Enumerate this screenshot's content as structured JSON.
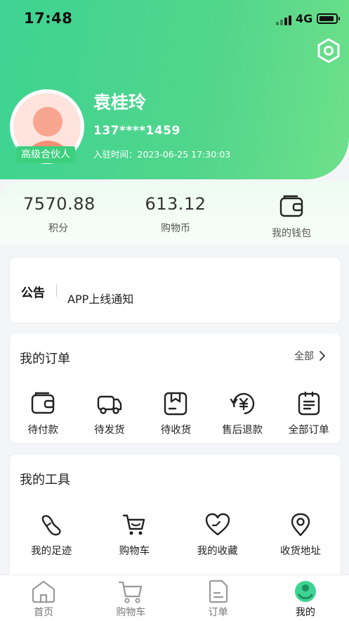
{
  "status": {
    "time": "17:48",
    "network": "4G"
  },
  "profile": {
    "name": "袁桂玲",
    "phone": "137****1459",
    "joined": "入驻时间：2023-06-25 17:30:03",
    "badge": "高级合伙人"
  },
  "stats": {
    "points_value": "7570.88",
    "points_label": "积分",
    "coins_value": "613.12",
    "coins_label": "购物币",
    "wallet_label": "我的钱包"
  },
  "notice": {
    "title": "公告",
    "text": "APP上线通知"
  },
  "orders": {
    "title": "我的订单",
    "all_label": "全部",
    "items": [
      {
        "label": "待付款",
        "icon": "wallet-icon"
      },
      {
        "label": "待发货",
        "icon": "truck-icon"
      },
      {
        "label": "待收货",
        "icon": "package-icon"
      },
      {
        "label": "售后退款",
        "icon": "refund-icon"
      },
      {
        "label": "全部订单",
        "icon": "document-icon"
      }
    ]
  },
  "tools": {
    "title": "我的工具",
    "items": [
      {
        "label": "我的足迹",
        "icon": "footprint-icon"
      },
      {
        "label": "购物车",
        "icon": "cart-icon"
      },
      {
        "label": "我的收藏",
        "icon": "heart-icon"
      },
      {
        "label": "收货地址",
        "icon": "location-icon"
      }
    ]
  },
  "tabbar": {
    "items": [
      {
        "label": "首页",
        "icon": "home-icon"
      },
      {
        "label": "购物车",
        "icon": "cart-icon"
      },
      {
        "label": "订单",
        "icon": "order-icon"
      },
      {
        "label": "我的",
        "icon": "profile-icon",
        "active": true
      }
    ]
  },
  "colors": {
    "brand": "#3dd392",
    "accent": "#3ccf7e"
  }
}
